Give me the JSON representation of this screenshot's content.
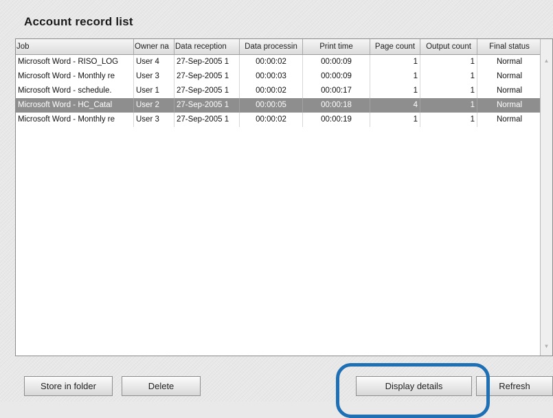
{
  "window": {
    "title": "Account record list"
  },
  "table": {
    "headers": [
      "Job",
      "Owner na",
      "Data reception",
      "Data processin",
      "Print time",
      "Page count",
      "Output count",
      "Final status"
    ],
    "rows": [
      {
        "job": "Microsoft Word - RISO_LOG",
        "owner": "User 4",
        "reception": "27-Sep-2005 1",
        "processing": "00:00:02",
        "print_time": "00:00:09",
        "page_count": "1",
        "output_count": "1",
        "final_status": "Normal",
        "selected": false
      },
      {
        "job": "Microsoft Word - Monthly re",
        "owner": "User 3",
        "reception": "27-Sep-2005 1",
        "processing": "00:00:03",
        "print_time": "00:00:09",
        "page_count": "1",
        "output_count": "1",
        "final_status": "Normal",
        "selected": false
      },
      {
        "job": "Microsoft Word - schedule.",
        "owner": "User 1",
        "reception": "27-Sep-2005 1",
        "processing": "00:00:02",
        "print_time": "00:00:17",
        "page_count": "1",
        "output_count": "1",
        "final_status": "Normal",
        "selected": false
      },
      {
        "job": "Microsoft Word - HC_Catal",
        "owner": "User 2",
        "reception": "27-Sep-2005 1",
        "processing": "00:00:05",
        "print_time": "00:00:18",
        "page_count": "4",
        "output_count": "1",
        "final_status": "Normal",
        "selected": true
      },
      {
        "job": "Microsoft Word - Monthly re",
        "owner": "User 3",
        "reception": "27-Sep-2005 1",
        "processing": "00:00:02",
        "print_time": "00:00:19",
        "page_count": "1",
        "output_count": "1",
        "final_status": "Normal",
        "selected": false
      }
    ]
  },
  "buttons": {
    "store": "Store in folder",
    "delete": "Delete",
    "details": "Display details",
    "refresh": "Refresh"
  },
  "icons": {
    "scroll_up": "scroll-up-arrow-icon",
    "scroll_down": "scroll-down-arrow-icon"
  },
  "colors": {
    "highlight": "#1f6fb4",
    "selected_row": "#8e8e8e"
  }
}
